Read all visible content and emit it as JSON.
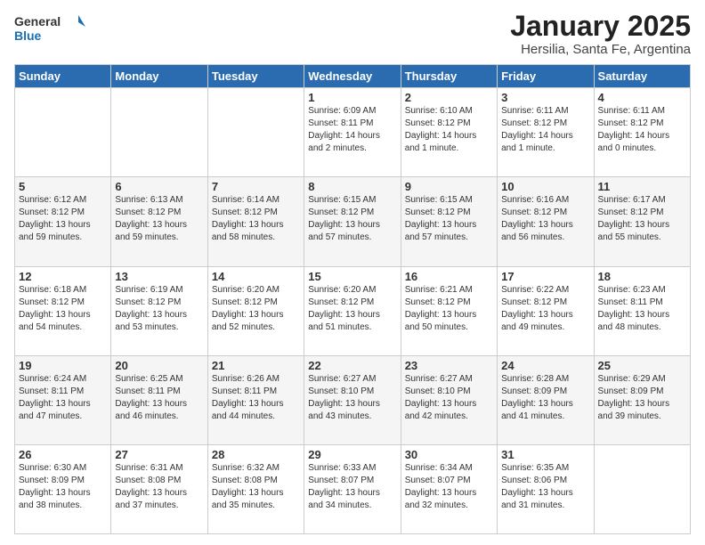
{
  "logo": {
    "line1": "General",
    "line2": "Blue"
  },
  "title": "January 2025",
  "subtitle": "Hersilia, Santa Fe, Argentina",
  "days_header": [
    "Sunday",
    "Monday",
    "Tuesday",
    "Wednesday",
    "Thursday",
    "Friday",
    "Saturday"
  ],
  "weeks": [
    [
      {
        "day": "",
        "info": ""
      },
      {
        "day": "",
        "info": ""
      },
      {
        "day": "",
        "info": ""
      },
      {
        "day": "1",
        "info": "Sunrise: 6:09 AM\nSunset: 8:11 PM\nDaylight: 14 hours\nand 2 minutes."
      },
      {
        "day": "2",
        "info": "Sunrise: 6:10 AM\nSunset: 8:12 PM\nDaylight: 14 hours\nand 1 minute."
      },
      {
        "day": "3",
        "info": "Sunrise: 6:11 AM\nSunset: 8:12 PM\nDaylight: 14 hours\nand 1 minute."
      },
      {
        "day": "4",
        "info": "Sunrise: 6:11 AM\nSunset: 8:12 PM\nDaylight: 14 hours\nand 0 minutes."
      }
    ],
    [
      {
        "day": "5",
        "info": "Sunrise: 6:12 AM\nSunset: 8:12 PM\nDaylight: 13 hours\nand 59 minutes."
      },
      {
        "day": "6",
        "info": "Sunrise: 6:13 AM\nSunset: 8:12 PM\nDaylight: 13 hours\nand 59 minutes."
      },
      {
        "day": "7",
        "info": "Sunrise: 6:14 AM\nSunset: 8:12 PM\nDaylight: 13 hours\nand 58 minutes."
      },
      {
        "day": "8",
        "info": "Sunrise: 6:15 AM\nSunset: 8:12 PM\nDaylight: 13 hours\nand 57 minutes."
      },
      {
        "day": "9",
        "info": "Sunrise: 6:15 AM\nSunset: 8:12 PM\nDaylight: 13 hours\nand 57 minutes."
      },
      {
        "day": "10",
        "info": "Sunrise: 6:16 AM\nSunset: 8:12 PM\nDaylight: 13 hours\nand 56 minutes."
      },
      {
        "day": "11",
        "info": "Sunrise: 6:17 AM\nSunset: 8:12 PM\nDaylight: 13 hours\nand 55 minutes."
      }
    ],
    [
      {
        "day": "12",
        "info": "Sunrise: 6:18 AM\nSunset: 8:12 PM\nDaylight: 13 hours\nand 54 minutes."
      },
      {
        "day": "13",
        "info": "Sunrise: 6:19 AM\nSunset: 8:12 PM\nDaylight: 13 hours\nand 53 minutes."
      },
      {
        "day": "14",
        "info": "Sunrise: 6:20 AM\nSunset: 8:12 PM\nDaylight: 13 hours\nand 52 minutes."
      },
      {
        "day": "15",
        "info": "Sunrise: 6:20 AM\nSunset: 8:12 PM\nDaylight: 13 hours\nand 51 minutes."
      },
      {
        "day": "16",
        "info": "Sunrise: 6:21 AM\nSunset: 8:12 PM\nDaylight: 13 hours\nand 50 minutes."
      },
      {
        "day": "17",
        "info": "Sunrise: 6:22 AM\nSunset: 8:12 PM\nDaylight: 13 hours\nand 49 minutes."
      },
      {
        "day": "18",
        "info": "Sunrise: 6:23 AM\nSunset: 8:11 PM\nDaylight: 13 hours\nand 48 minutes."
      }
    ],
    [
      {
        "day": "19",
        "info": "Sunrise: 6:24 AM\nSunset: 8:11 PM\nDaylight: 13 hours\nand 47 minutes."
      },
      {
        "day": "20",
        "info": "Sunrise: 6:25 AM\nSunset: 8:11 PM\nDaylight: 13 hours\nand 46 minutes."
      },
      {
        "day": "21",
        "info": "Sunrise: 6:26 AM\nSunset: 8:11 PM\nDaylight: 13 hours\nand 44 minutes."
      },
      {
        "day": "22",
        "info": "Sunrise: 6:27 AM\nSunset: 8:10 PM\nDaylight: 13 hours\nand 43 minutes."
      },
      {
        "day": "23",
        "info": "Sunrise: 6:27 AM\nSunset: 8:10 PM\nDaylight: 13 hours\nand 42 minutes."
      },
      {
        "day": "24",
        "info": "Sunrise: 6:28 AM\nSunset: 8:09 PM\nDaylight: 13 hours\nand 41 minutes."
      },
      {
        "day": "25",
        "info": "Sunrise: 6:29 AM\nSunset: 8:09 PM\nDaylight: 13 hours\nand 39 minutes."
      }
    ],
    [
      {
        "day": "26",
        "info": "Sunrise: 6:30 AM\nSunset: 8:09 PM\nDaylight: 13 hours\nand 38 minutes."
      },
      {
        "day": "27",
        "info": "Sunrise: 6:31 AM\nSunset: 8:08 PM\nDaylight: 13 hours\nand 37 minutes."
      },
      {
        "day": "28",
        "info": "Sunrise: 6:32 AM\nSunset: 8:08 PM\nDaylight: 13 hours\nand 35 minutes."
      },
      {
        "day": "29",
        "info": "Sunrise: 6:33 AM\nSunset: 8:07 PM\nDaylight: 13 hours\nand 34 minutes."
      },
      {
        "day": "30",
        "info": "Sunrise: 6:34 AM\nSunset: 8:07 PM\nDaylight: 13 hours\nand 32 minutes."
      },
      {
        "day": "31",
        "info": "Sunrise: 6:35 AM\nSunset: 8:06 PM\nDaylight: 13 hours\nand 31 minutes."
      },
      {
        "day": "",
        "info": ""
      }
    ]
  ]
}
